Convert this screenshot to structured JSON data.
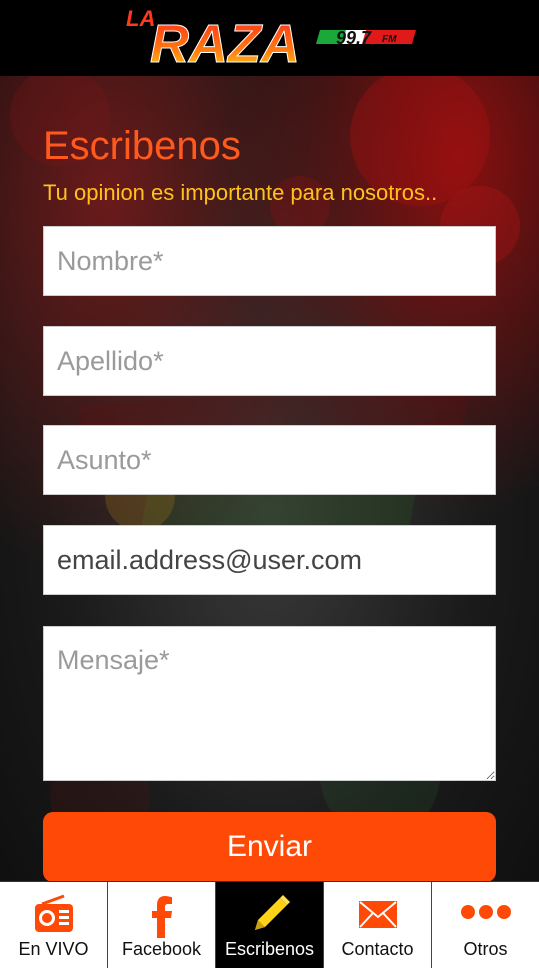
{
  "header": {
    "logo_main": "RAZA",
    "logo_prefix": "LA",
    "logo_freq": "99.7",
    "logo_band": "FM"
  },
  "form": {
    "title": "Escribenos",
    "subtitle": "Tu opinion es importante para nosotros..",
    "nombre_placeholder": "Nombre*",
    "apellido_placeholder": "Apellido*",
    "asunto_placeholder": "Asunto*",
    "email_value": "email.address@user.com",
    "mensaje_placeholder": "Mensaje*",
    "submit_label": "Enviar"
  },
  "tabs": [
    {
      "label": "En VIVO",
      "icon": "radio-icon",
      "active": false
    },
    {
      "label": "Facebook",
      "icon": "facebook-icon",
      "active": false
    },
    {
      "label": "Escribenos",
      "icon": "pencil-icon",
      "active": true
    },
    {
      "label": "Contacto",
      "icon": "envelope-icon",
      "active": false
    },
    {
      "label": "Otros",
      "icon": "more-dots-icon",
      "active": false
    }
  ],
  "colors": {
    "accent": "#ff4a07",
    "title": "#ff5a1e",
    "subtitle": "#ffc21a",
    "icon": "#ff4a07"
  }
}
